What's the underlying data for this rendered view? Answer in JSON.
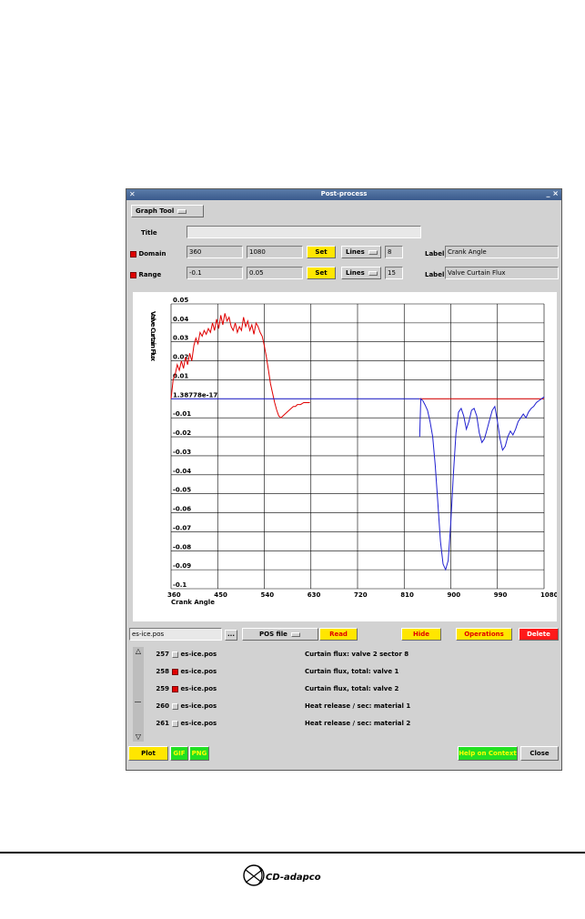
{
  "window": {
    "title": "Post-process"
  },
  "toolbar": {
    "graph_tool": "Graph Tool"
  },
  "title_row": {
    "label": "Title",
    "value": ""
  },
  "domain": {
    "label": "Domain",
    "min": "360",
    "max": "1080",
    "set": "Set",
    "lines_label": "Lines",
    "lines_value": "8",
    "axis_label_caption": "Label",
    "axis_label": "Crank Angle"
  },
  "range": {
    "label": "Range",
    "min": "-0.1",
    "max": "0.05",
    "set": "Set",
    "lines_label": "Lines",
    "lines_value": "15",
    "axis_label_caption": "Label",
    "axis_label": "Valve Curtain Flux"
  },
  "chart_data": {
    "type": "line",
    "xlabel": "Crank Angle",
    "ylabel": "Valve Curtain Flux",
    "xlim": [
      360,
      1080
    ],
    "ylim": [
      -0.1,
      0.05
    ],
    "x_ticks": [
      "360",
      "450",
      "540",
      "630",
      "720",
      "810",
      "900",
      "990",
      "1080"
    ],
    "y_ticks": [
      "0.05",
      "0.04",
      "0.03",
      "0.02",
      "0.01",
      "1.38778e-17",
      "-0.01",
      "-0.02",
      "-0.03",
      "-0.04",
      "-0.05",
      "-0.06",
      "-0.07",
      "-0.08",
      "-0.09",
      "-0.1"
    ],
    "grid": true,
    "series": [
      {
        "color": "#e00000",
        "x": [
          360,
          364,
          368,
          372,
          376,
          380,
          384,
          388,
          392,
          396,
          400,
          404,
          408,
          412,
          416,
          420,
          424,
          428,
          432,
          436,
          440,
          444,
          448,
          452,
          456,
          460,
          464,
          468,
          472,
          476,
          480,
          484,
          488,
          492,
          496,
          500,
          504,
          508,
          512,
          516,
          520,
          524,
          528,
          532,
          536,
          540,
          544,
          548,
          552,
          556,
          560,
          564,
          568,
          572,
          576,
          580,
          584,
          588,
          592,
          596,
          600,
          604,
          610,
          616,
          622,
          628
        ],
        "y": [
          0.0,
          0.01,
          0.013,
          0.018,
          0.015,
          0.02,
          0.016,
          0.022,
          0.018,
          0.024,
          0.02,
          0.028,
          0.032,
          0.029,
          0.035,
          0.033,
          0.036,
          0.034,
          0.037,
          0.035,
          0.04,
          0.036,
          0.042,
          0.037,
          0.044,
          0.039,
          0.045,
          0.041,
          0.043,
          0.038,
          0.036,
          0.04,
          0.035,
          0.038,
          0.036,
          0.043,
          0.038,
          0.041,
          0.036,
          0.039,
          0.034,
          0.04,
          0.038,
          0.035,
          0.033,
          0.028,
          0.022,
          0.015,
          0.008,
          0.003,
          -0.002,
          -0.006,
          -0.009,
          -0.01,
          -0.009,
          -0.008,
          -0.007,
          -0.006,
          -0.005,
          -0.004,
          -0.004,
          -0.003,
          -0.003,
          -0.002,
          -0.002,
          -0.002
        ]
      },
      {
        "color": "#e00000",
        "x": [
          840,
          880,
          920,
          960,
          1000,
          1040,
          1060,
          1080
        ],
        "y": [
          0.0,
          0.0,
          0.0,
          0.0,
          0.0,
          0.0,
          0.0,
          0.0
        ]
      },
      {
        "color": "#2020d0",
        "x": [
          360,
          420,
          480,
          540,
          600,
          660,
          720,
          780,
          840
        ],
        "y": [
          0.0,
          0.0,
          0.0,
          0.0,
          0.0,
          0.0,
          0.0,
          0.0,
          0.0
        ]
      },
      {
        "color": "#2020d0",
        "x": [
          840,
          842,
          846,
          850,
          855,
          860,
          865,
          870,
          875,
          880,
          885,
          890,
          895,
          900,
          905,
          910,
          915,
          920,
          925,
          930,
          935,
          940,
          945,
          950,
          955,
          960,
          965,
          970,
          975,
          980,
          985,
          990,
          995,
          1000,
          1005,
          1010,
          1015,
          1020,
          1025,
          1030,
          1035,
          1040,
          1045,
          1050,
          1055,
          1060,
          1065,
          1070,
          1075,
          1080
        ],
        "y": [
          -0.02,
          0.0,
          -0.001,
          -0.003,
          -0.006,
          -0.012,
          -0.02,
          -0.035,
          -0.055,
          -0.075,
          -0.087,
          -0.09,
          -0.085,
          -0.065,
          -0.04,
          -0.018,
          -0.007,
          -0.005,
          -0.009,
          -0.016,
          -0.012,
          -0.006,
          -0.005,
          -0.009,
          -0.018,
          -0.023,
          -0.021,
          -0.016,
          -0.011,
          -0.006,
          -0.004,
          -0.012,
          -0.021,
          -0.027,
          -0.025,
          -0.02,
          -0.017,
          -0.019,
          -0.016,
          -0.012,
          -0.01,
          -0.008,
          -0.01,
          -0.007,
          -0.005,
          -0.004,
          -0.002,
          -0.001,
          0.0,
          0.001
        ]
      }
    ]
  },
  "file_bar": {
    "file": "es-ice.pos",
    "browse": "...",
    "type": "POS file",
    "read": "Read",
    "hide": "Hide",
    "operations": "Operations",
    "delete": "Delete"
  },
  "list": [
    {
      "num": "257",
      "file": "es-ice.pos",
      "checked": false,
      "desc": "Curtain flux: valve 2 sector 8"
    },
    {
      "num": "258",
      "file": "es-ice.pos",
      "checked": true,
      "desc": "Curtain flux, total: valve 1"
    },
    {
      "num": "259",
      "file": "es-ice.pos",
      "checked": true,
      "desc": "Curtain flux, total: valve 2"
    },
    {
      "num": "260",
      "file": "es-ice.pos",
      "checked": false,
      "desc": "Heat release / sec: material 1"
    },
    {
      "num": "261",
      "file": "es-ice.pos",
      "checked": false,
      "desc": "Heat release / sec: material 2"
    }
  ],
  "bottom": {
    "plot": "Plot",
    "gif": "GIF",
    "png": "PNG",
    "help": "Help on Context",
    "close": "Close"
  },
  "footer": {
    "brand": "CD-adapco"
  },
  "colors": {
    "title_bar": "#3a5a8c",
    "yellow": "#ffe600",
    "red": "#ff1a1a",
    "green": "#22e022"
  }
}
